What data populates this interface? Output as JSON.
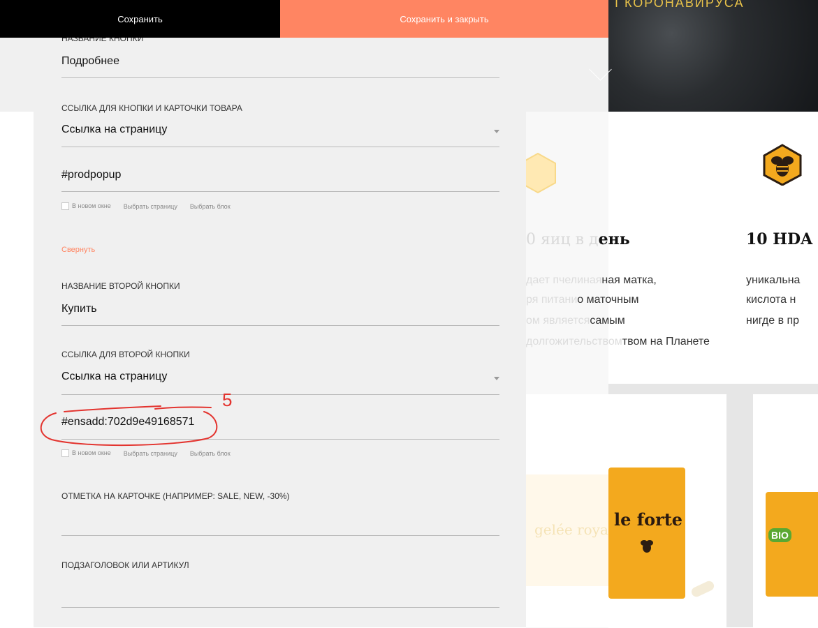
{
  "topbar": {
    "save_label": "Сохранить",
    "save_close_label": "Сохранить и закрыть"
  },
  "form": {
    "button_name": {
      "label": "НАЗВАНИЕ КНОПКИ",
      "value": "Подробнее"
    },
    "button_link": {
      "label": "ССЫЛКА ДЛЯ КНОПКИ И КАРТОЧКИ ТОВАРА",
      "select_value": "Ссылка на страницу",
      "url_value": "#prodpopup"
    },
    "link_options": {
      "new_window": "В новом окне",
      "pick_page": "Выбрать страницу",
      "pick_block": "Выбрать блок"
    },
    "collapse_label": "Свернуть",
    "second_button_name": {
      "label": "НАЗВАНИЕ ВТОРОЙ КНОПКИ",
      "value": "Купить"
    },
    "second_button_link": {
      "label": "ССЫЛКА ДЛЯ ВТОРОЙ КНОПКИ",
      "select_value": "Ссылка на страницу",
      "url_value": "#ensadd:702d9e49168571"
    },
    "card_mark": {
      "label": "ОТМЕТКА НА КАРТОЧКЕ (НАПРИМЕР: SALE, NEW, -30%)",
      "value": ""
    },
    "subtitle": {
      "label": "ПОДЗАГОЛОВОК ИЛИ АРТИКУЛ",
      "value": ""
    }
  },
  "annotation": {
    "mark": "5"
  },
  "site": {
    "hero_title": "І КОРОНАВИРУСА",
    "feature_1": {
      "title_faint": "0 яиц в д",
      "title": "ень",
      "lines_faint": [
        "дает пчелиная",
        "ря питани",
        "ом является",
        "долгожительством"
      ],
      "lines": [
        "ная матка,",
        "о маточным",
        "самым",
        "твом на Планете"
      ]
    },
    "feature_2": {
      "title": "10 HDA",
      "lines": [
        "уникальна",
        "кислота н",
        "нигде в пр"
      ]
    },
    "product_1_text": "le forte",
    "product_1_faint": "gelée royale",
    "product_2_text": "BIO"
  },
  "colors": {
    "accent": "#ff8562",
    "annotation": "#e3342f",
    "honey": "#f3a91e"
  }
}
